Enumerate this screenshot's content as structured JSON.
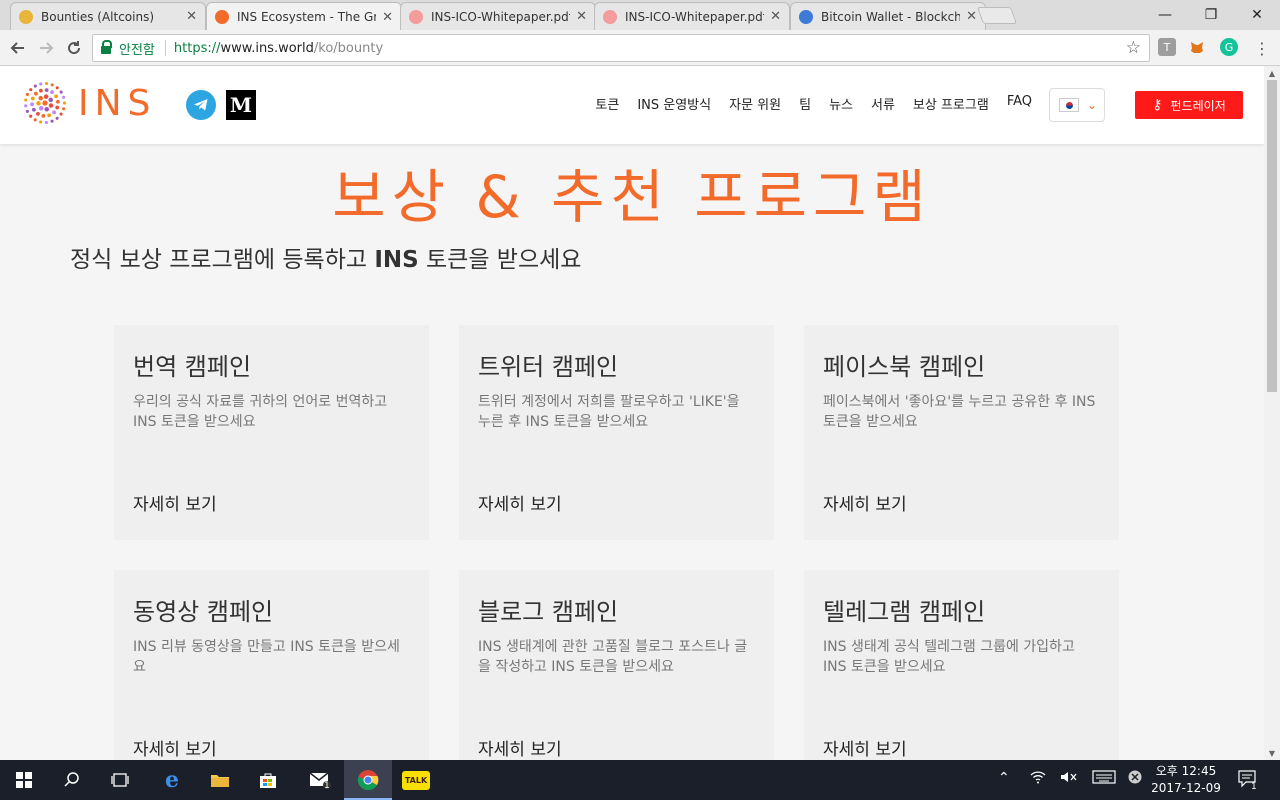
{
  "browser": {
    "tabs": [
      {
        "title": "Bounties (Altcoins)",
        "favicon_color": "#e8b53a",
        "active": false
      },
      {
        "title": "INS Ecosystem - The Gr",
        "favicon_color": "#f26b2a",
        "active": true
      },
      {
        "title": "INS-ICO-Whitepaper.pdf",
        "favicon_color": "#f49b9b",
        "active": false
      },
      {
        "title": "INS-ICO-Whitepaper.pdf",
        "favicon_color": "#f49b9b",
        "active": false
      },
      {
        "title": "Bitcoin Wallet - Blockch",
        "favicon_color": "#3e7bd6",
        "active": false
      }
    ],
    "close_glyph": "✕",
    "window": {
      "minimize": "—",
      "restore": "❐",
      "close": "✕"
    },
    "secure_label": "안전함",
    "url": {
      "scheme": "https://",
      "host": "www.ins.world",
      "path": "/ko/bounty"
    },
    "extensions": [
      {
        "name": "t-extension-icon",
        "glyph": "T",
        "bg": "#9e9e9e"
      },
      {
        "name": "metamask-icon",
        "glyph": "🦊",
        "bg": "transparent"
      },
      {
        "name": "grammarly-icon",
        "glyph": "G",
        "bg": "#15c39a"
      }
    ]
  },
  "site": {
    "logo_text": "INS",
    "nav": [
      "토큰",
      "INS 운영방식",
      "자문 위원",
      "팀",
      "뉴스",
      "서류",
      "보상 프로그램",
      "FAQ"
    ],
    "medium_label": "M",
    "fund_button": "펀드레이저",
    "accent_color": "#f26b2a",
    "cta_color": "#ff1a1a"
  },
  "page": {
    "title": "보상 & 추천 프로그램",
    "subtitle_prefix": "정식 보상 프로그램에 등록하고 ",
    "subtitle_bold": "INS",
    "subtitle_suffix": " 토큰을 받으세요",
    "cards": [
      {
        "title": "번역 캠페인",
        "desc": "우리의 공식 자료를 귀하의 언어로 번역하고 INS 토큰을 받으세요",
        "link": "자세히 보기"
      },
      {
        "title": "트위터 캠페인",
        "desc": "트위터 계정에서 저희를 팔로우하고 'LIKE'을 누른 후 INS 토큰을 받으세요",
        "link": "자세히 보기"
      },
      {
        "title": "페이스북 캠페인",
        "desc": "페이스북에서 '좋아요'를 누르고 공유한 후 INS 토큰을 받으세요",
        "link": "자세히 보기"
      },
      {
        "title": "동영상 캠페인",
        "desc": "INS 리뷰 동영상을 만들고 INS 토큰을 받으세요",
        "link": "자세히 보기"
      },
      {
        "title": "블로그 캠페인",
        "desc": "INS 생태계에 관한 고품질 블로그 포스트나 글을 작성하고 INS 토큰을 받으세요",
        "link": "자세히 보기"
      },
      {
        "title": "텔레그램 캠페인",
        "desc": "INS 생태계 공식 텔레그램 그룹에 가입하고 INS 토큰을 받으세요",
        "link": "자세히 보기"
      }
    ]
  },
  "taskbar": {
    "clock_time": "오후 12:45",
    "clock_date": "2017-12-09",
    "mail_badge": "1",
    "notify_badge": "1",
    "kakao_label": "TALK"
  }
}
